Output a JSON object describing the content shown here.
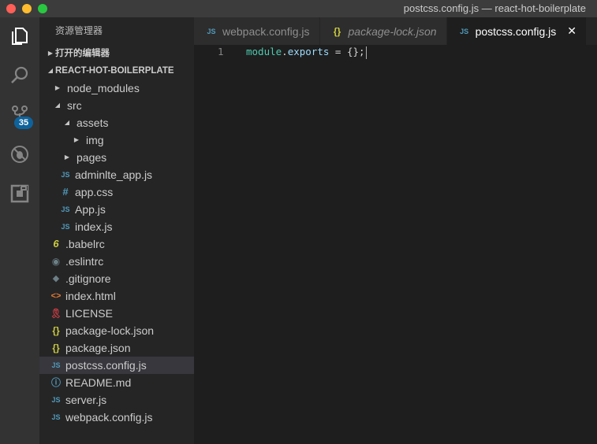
{
  "window": {
    "title": "postcss.config.js — react-hot-boilerplate"
  },
  "activity_bar": {
    "icons": [
      "files-icon",
      "search-icon",
      "source-control-icon",
      "debug-icon",
      "extensions-icon"
    ],
    "source_control_badge": "35"
  },
  "sidebar": {
    "title": "资源管理器",
    "open_editors_label": "打开的编辑器",
    "project_label": "REACT-HOT-BOILERPLATE",
    "tree": [
      {
        "label": "node_modules",
        "kind": "folder",
        "expanded": false,
        "depth": 1
      },
      {
        "label": "src",
        "kind": "folder",
        "expanded": true,
        "depth": 1
      },
      {
        "label": "assets",
        "kind": "folder",
        "expanded": true,
        "depth": 2
      },
      {
        "label": "img",
        "kind": "folder",
        "expanded": false,
        "depth": 3
      },
      {
        "label": "pages",
        "kind": "folder",
        "expanded": false,
        "depth": 2
      },
      {
        "label": "adminlte_app.js",
        "kind": "js",
        "icon": "JS",
        "depth": 2
      },
      {
        "label": "app.css",
        "kind": "css",
        "icon": "#",
        "depth": 2
      },
      {
        "label": "App.js",
        "kind": "js",
        "icon": "JS",
        "depth": 2
      },
      {
        "label": "index.js",
        "kind": "js",
        "icon": "JS",
        "depth": 2
      },
      {
        "label": ".babelrc",
        "kind": "babel",
        "icon": "6",
        "depth": 1
      },
      {
        "label": ".eslintrc",
        "kind": "eslint",
        "icon": "◉",
        "depth": 1
      },
      {
        "label": ".gitignore",
        "kind": "git",
        "icon": "◆",
        "depth": 1
      },
      {
        "label": "index.html",
        "kind": "html",
        "icon": "<>",
        "depth": 1
      },
      {
        "label": "LICENSE",
        "kind": "license",
        "icon": "🎗",
        "depth": 1
      },
      {
        "label": "package-lock.json",
        "kind": "json",
        "icon": "{}",
        "depth": 1
      },
      {
        "label": "package.json",
        "kind": "json",
        "icon": "{}",
        "depth": 1
      },
      {
        "label": "postcss.config.js",
        "kind": "js",
        "icon": "JS",
        "depth": 1,
        "selected": true
      },
      {
        "label": "README.md",
        "kind": "info",
        "icon": "ⓘ",
        "depth": 1
      },
      {
        "label": "server.js",
        "kind": "js",
        "icon": "JS",
        "depth": 1
      },
      {
        "label": "webpack.config.js",
        "kind": "js",
        "icon": "JS",
        "depth": 1
      }
    ]
  },
  "tabs": [
    {
      "label": "webpack.config.js",
      "icon": "JS",
      "kind": "js",
      "italic": false,
      "active": false
    },
    {
      "label": "package-lock.json",
      "icon": "{}",
      "kind": "json",
      "italic": true,
      "active": false
    },
    {
      "label": "postcss.config.js",
      "icon": "JS",
      "kind": "js",
      "italic": false,
      "active": true
    }
  ],
  "tab_close_glyph": "✕",
  "editor": {
    "line_number": "1",
    "tokens": [
      {
        "text": "module",
        "cls": "tok-var"
      },
      {
        "text": ".",
        "cls": "tok-punc"
      },
      {
        "text": "exports",
        "cls": "tok-prop"
      },
      {
        "text": " = {};",
        "cls": "tok-punc"
      }
    ]
  }
}
